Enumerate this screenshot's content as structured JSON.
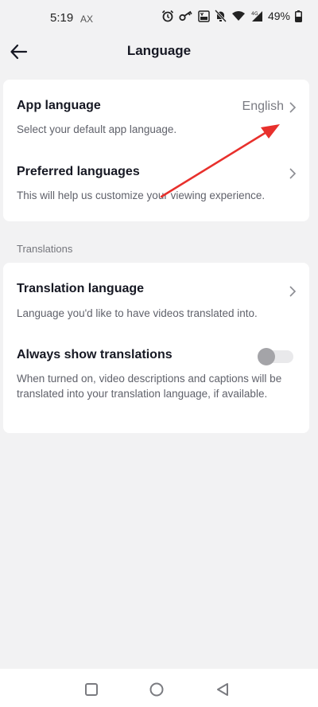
{
  "status_bar": {
    "time": "5:19",
    "carrier_tag": "AX",
    "battery_percent": "49%",
    "icons": [
      "alarm-icon",
      "key-icon",
      "volte-icon",
      "mute-icon",
      "wifi-icon",
      "signal-4g-icon",
      "battery-icon"
    ]
  },
  "header": {
    "title": "Language",
    "back_icon": "arrow-left-icon"
  },
  "card_general": {
    "app_language": {
      "title": "App language",
      "subtitle": "Select your default app language.",
      "value": "English"
    },
    "preferred_languages": {
      "title": "Preferred languages",
      "subtitle": "This will help us customize your viewing experience."
    }
  },
  "translations_section": {
    "label": "Translations",
    "translation_language": {
      "title": "Translation language",
      "subtitle": "Language you'd like to have videos translated into."
    },
    "always_show": {
      "title": "Always show translations",
      "subtitle": "When turned on, video descriptions and captions will be translated into your translation language, if available.",
      "enabled": false
    }
  },
  "annotation": {
    "color": "#e8302c"
  },
  "nav_bar": {
    "icons": [
      "recents-square-icon",
      "home-circle-icon",
      "back-triangle-icon"
    ]
  },
  "colors": {
    "background": "#f2f2f3",
    "card": "#ffffff",
    "title_text": "#161823",
    "secondary_text": "#60626b"
  }
}
